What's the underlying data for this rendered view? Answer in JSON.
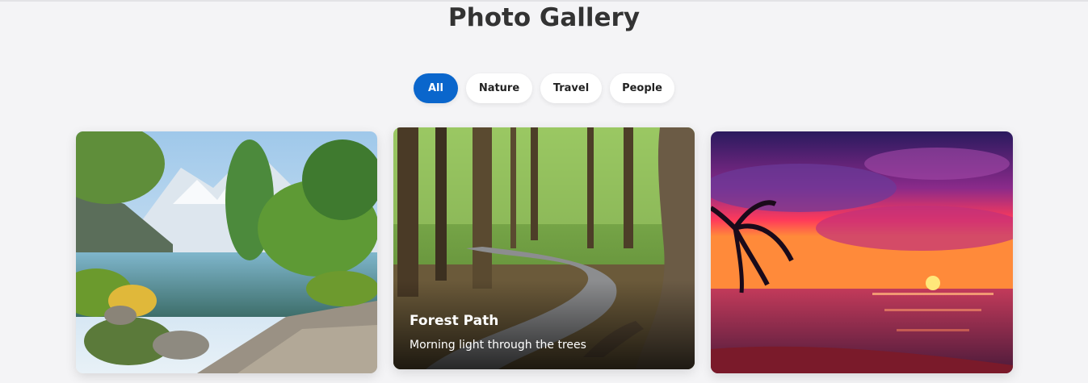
{
  "page": {
    "title": "Photo Gallery"
  },
  "filters": [
    {
      "label": "All",
      "active": true
    },
    {
      "label": "Nature",
      "active": false
    },
    {
      "label": "Travel",
      "active": false
    },
    {
      "label": "People",
      "active": false
    }
  ],
  "cards": [
    {
      "image": "lake-landscape",
      "title": "",
      "subtitle": ""
    },
    {
      "image": "forest-path",
      "title": "Forest Path",
      "subtitle": "Morning light through the trees"
    },
    {
      "image": "tropical-sunset",
      "title": "",
      "subtitle": ""
    }
  ],
  "colors": {
    "accent": "#0a66cc",
    "background": "#f4f4f6",
    "heading": "#333333"
  }
}
